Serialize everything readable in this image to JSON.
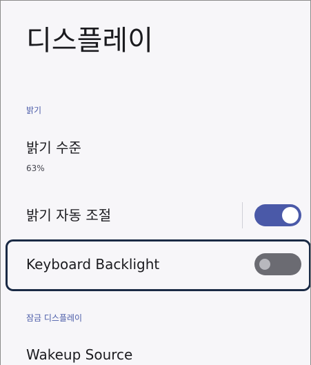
{
  "page": {
    "title": "디스플레이"
  },
  "sections": {
    "brightness": {
      "header": "밝기",
      "brightness_level": {
        "title": "밝기 수준",
        "summary": "63%"
      },
      "auto_brightness": {
        "title": "밝기 자동 조절",
        "enabled": true
      },
      "keyboard_backlight": {
        "title": "Keyboard Backlight",
        "enabled": false
      }
    },
    "lock_display": {
      "header": "잠금 디스플레이",
      "wakeup_source": {
        "title": "Wakeup Source"
      }
    }
  },
  "colors": {
    "accent": "#4a59a8",
    "switch_off_track": "#6b6b72",
    "highlight_border": "#1a2a45",
    "background": "#f7f6f9"
  }
}
